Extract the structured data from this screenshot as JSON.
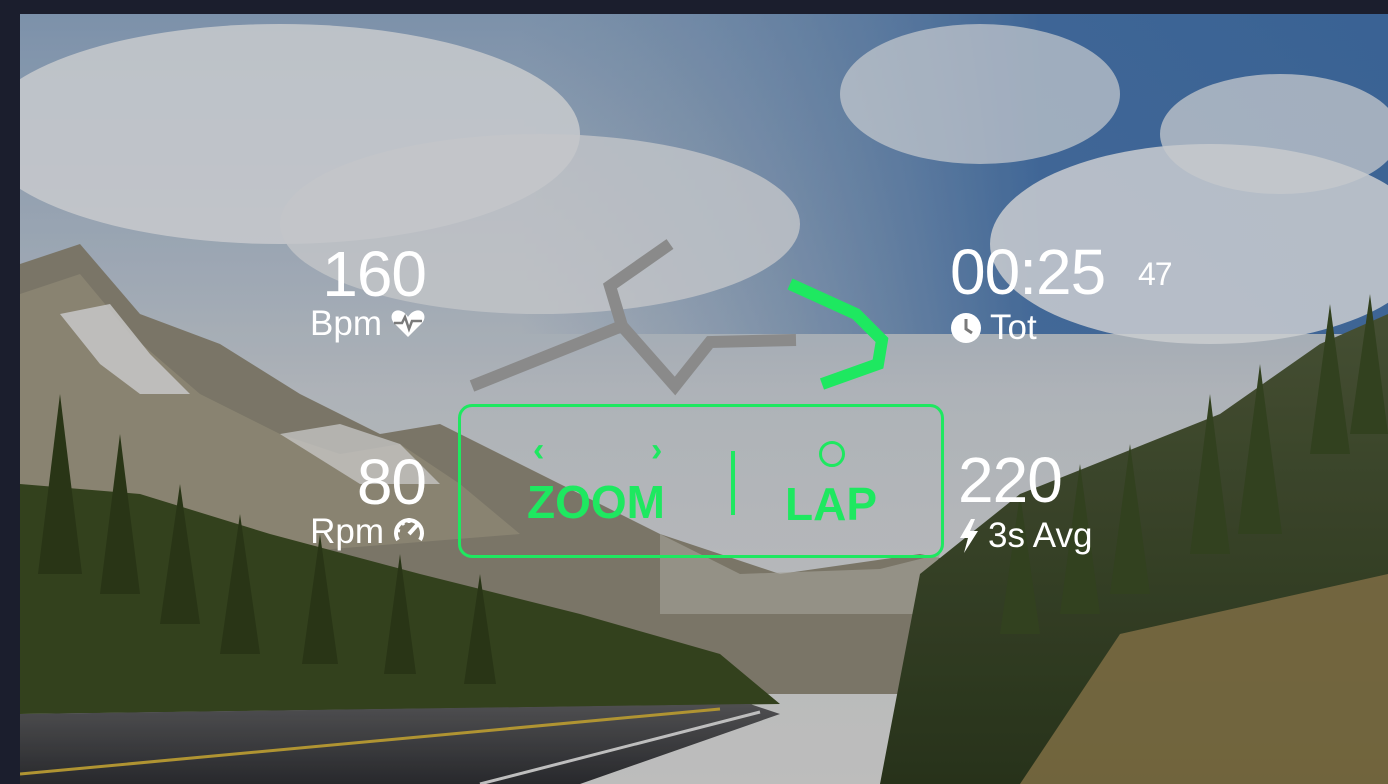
{
  "hud": {
    "heart_rate": {
      "value": "160",
      "unit": "Bpm",
      "icon": "heart-pulse-icon"
    },
    "cadence": {
      "value": "80",
      "unit": "Rpm",
      "icon": "cadence-gauge-icon"
    },
    "timer": {
      "value": "00:25",
      "fraction": "47",
      "label": "Tot",
      "icon": "clock-icon"
    },
    "power": {
      "value": "220",
      "label": "3s Avg",
      "icon": "lightning-icon"
    }
  },
  "controls": {
    "zoom_label": "ZOOM",
    "zoom_prev_glyph": "‹",
    "zoom_next_glyph": "›",
    "lap_label": "LAP",
    "accent_color": "#1ee860"
  },
  "route": {
    "completed_color": "#1ee860",
    "remaining_color": "#8a8a8a"
  }
}
